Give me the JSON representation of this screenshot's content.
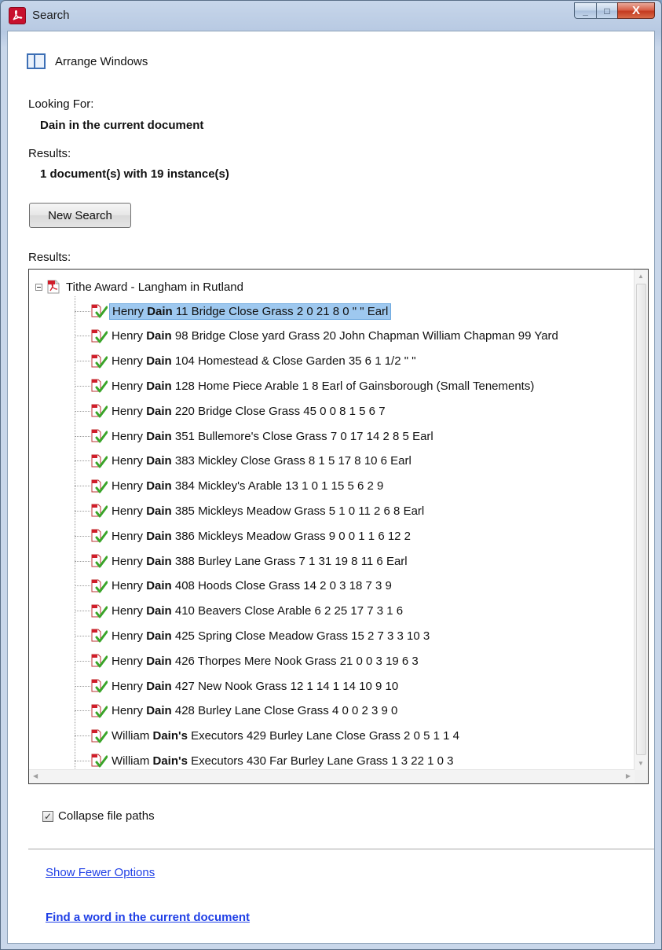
{
  "window": {
    "title": "Search",
    "buttons": {
      "minimize": "_",
      "maximize": "□",
      "close": "X"
    }
  },
  "arrange": {
    "label": "Arrange Windows"
  },
  "looking_for": {
    "label": "Looking For:",
    "value": "Dain in the current document"
  },
  "results_summary": {
    "label": "Results:",
    "value": "1 document(s) with 19 instance(s)"
  },
  "new_search": {
    "label": "New Search"
  },
  "results_tree": {
    "label": "Results:",
    "root": "Tithe Award - Langham in Rutland",
    "items": [
      {
        "pre": "Henry ",
        "hit": "Dain",
        "post": " 11 Bridge Close Grass 2 0 21 8 0 \" \" Earl"
      },
      {
        "pre": "Henry ",
        "hit": "Dain",
        "post": " 98 Bridge Close yard Grass 20 John Chapman William Chapman 99 Yard"
      },
      {
        "pre": "Henry ",
        "hit": "Dain",
        "post": " 104 Homestead & Close Garden 35 6 1 1/2 \" \""
      },
      {
        "pre": "Henry ",
        "hit": "Dain",
        "post": " 128 Home Piece Arable 1 8 Earl of Gainsborough (Small Tenements)"
      },
      {
        "pre": "Henry ",
        "hit": "Dain",
        "post": " 220 Bridge Close Grass 45 0 0 8 1 5 6 7"
      },
      {
        "pre": "Henry ",
        "hit": "Dain",
        "post": " 351 Bullemore's Close Grass 7 0 17 14 2 8 5 Earl"
      },
      {
        "pre": "Henry ",
        "hit": "Dain",
        "post": " 383 Mickley Close Grass 8 1 5 17 8 10 6 Earl"
      },
      {
        "pre": "Henry ",
        "hit": "Dain",
        "post": " 384 Mickley's Arable 13 1 0 1 15 5 6 2 9"
      },
      {
        "pre": "Henry ",
        "hit": "Dain",
        "post": " 385 Mickleys Meadow Grass 5 1 0 11 2 6 8 Earl"
      },
      {
        "pre": "Henry ",
        "hit": "Dain",
        "post": " 386 Mickleys Meadow Grass 9 0 0 1 1 6 12 2"
      },
      {
        "pre": "Henry ",
        "hit": "Dain",
        "post": " 388 Burley Lane Grass 7 1 31 19 8 11 6 Earl"
      },
      {
        "pre": "Henry ",
        "hit": "Dain",
        "post": " 408 Hoods Close Grass 14 2 0 3 18 7 3 9"
      },
      {
        "pre": "Henry ",
        "hit": "Dain",
        "post": " 410 Beavers Close Arable 6 2 25 17 7 3 1 6"
      },
      {
        "pre": "Henry ",
        "hit": "Dain",
        "post": " 425 Spring Close Meadow Grass 15 2 7 3 3 10 3"
      },
      {
        "pre": "Henry ",
        "hit": "Dain",
        "post": " 426 Thorpes Mere Nook Grass 21 0 0 3 19 6 3"
      },
      {
        "pre": "Henry ",
        "hit": "Dain",
        "post": " 427 New Nook Grass 12 1 14 1 14 10 9 10"
      },
      {
        "pre": "Henry ",
        "hit": "Dain",
        "post": " 428 Burley Lane Close Grass 4 0 0 2 3 9 0"
      },
      {
        "pre": "William ",
        "hit": "Dain's",
        "post": " Executors 429 Burley Lane Close Grass 2 0 5 1 1 4"
      },
      {
        "pre": "William ",
        "hit": "Dain's",
        "post": " Executors 430 Far Burley Lane Grass 1 3 22 1 0 3"
      }
    ]
  },
  "collapse_paths": {
    "label": "Collapse file paths",
    "checked": true
  },
  "links": {
    "fewer_options": "Show Fewer Options",
    "find_word": "Find a word in the current document"
  },
  "colors": {
    "accent": "#1f3fe6",
    "selection": "#9ec8ef",
    "app_icon": "#c8102e"
  }
}
